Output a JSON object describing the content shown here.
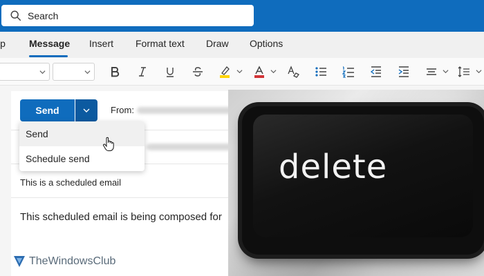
{
  "search": {
    "placeholder": "Search"
  },
  "tabs": [
    {
      "label": "lp"
    },
    {
      "label": "Message",
      "active": true
    },
    {
      "label": "Insert"
    },
    {
      "label": "Format text"
    },
    {
      "label": "Draw"
    },
    {
      "label": "Options"
    }
  ],
  "ribbon": {
    "tools": [
      "bold-icon",
      "italic-icon",
      "underline-icon",
      "strikethrough-icon",
      "highlight-icon",
      "font-color-icon",
      "clear-formatting-icon",
      "bullets-icon",
      "numbering-icon",
      "decrease-indent-icon",
      "increase-indent-icon",
      "align-icon",
      "line-spacing-icon"
    ],
    "highlight_color": "#ffd400",
    "font_color": "#d13438"
  },
  "compose": {
    "send_label": "Send",
    "from_label": "From:",
    "dropdown": [
      {
        "label": "Send"
      },
      {
        "label": "Schedule send"
      }
    ],
    "subject": "This is a scheduled email",
    "body": "This scheduled email is being composed for"
  },
  "photo": {
    "key_label": "delete"
  },
  "watermark": {
    "text": "TheWindowsClub"
  },
  "colors": {
    "brand_blue": "#0f6cbd",
    "split_blue": "#0c5aa0"
  }
}
